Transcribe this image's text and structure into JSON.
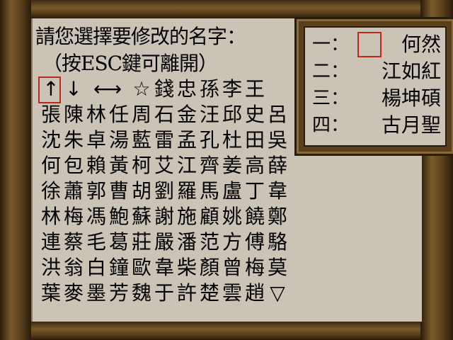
{
  "prompt": {
    "line1": "請您選擇要修改的名字：",
    "line2": "（按ESC鍵可離開）"
  },
  "controls": [
    "↑",
    "↓",
    "⟷",
    "☆"
  ],
  "grid_rows": [
    [
      "",
      "",
      "",
      "",
      "",
      "錢",
      "忠",
      "孫",
      "李",
      "王"
    ],
    [
      "張",
      "陳",
      "林",
      "任",
      "周",
      "石",
      "金",
      "汪",
      "邱",
      "史",
      "呂"
    ],
    [
      "沈",
      "朱",
      "卓",
      "湯",
      "藍",
      "雷",
      "孟",
      "孔",
      "杜",
      "田",
      "吳"
    ],
    [
      "何",
      "包",
      "賴",
      "黃",
      "柯",
      "艾",
      "江",
      "齊",
      "姜",
      "高",
      "薛"
    ],
    [
      "徐",
      "蕭",
      "郭",
      "曹",
      "胡",
      "劉",
      "羅",
      "馬",
      "盧",
      "丁",
      "韋"
    ],
    [
      "林",
      "梅",
      "馮",
      "鮑",
      "蘇",
      "謝",
      "施",
      "顧",
      "姚",
      "饒",
      "鄭"
    ],
    [
      "連",
      "蔡",
      "毛",
      "葛",
      "莊",
      "嚴",
      "潘",
      "范",
      "方",
      "傅",
      "駱"
    ],
    [
      "洪",
      "翁",
      "白",
      "鐘",
      "歐",
      "韋",
      "柴",
      "顏",
      "曾",
      "梅",
      "莫"
    ],
    [
      "葉",
      "麥",
      "墨",
      "芳",
      "魏",
      "于",
      "許",
      "楚",
      "雲",
      "趙",
      "▽"
    ]
  ],
  "name_slots": [
    {
      "label": "一：",
      "name": "何然"
    },
    {
      "label": "二：",
      "name": "江如紅"
    },
    {
      "label": "三：",
      "name": "楊坤碩"
    },
    {
      "label": "四：",
      "name": "古月聖"
    }
  ],
  "colors": {
    "parchment": "#cbc3b6",
    "cursor": "#c0281e",
    "wood": "#7a5a2a"
  }
}
